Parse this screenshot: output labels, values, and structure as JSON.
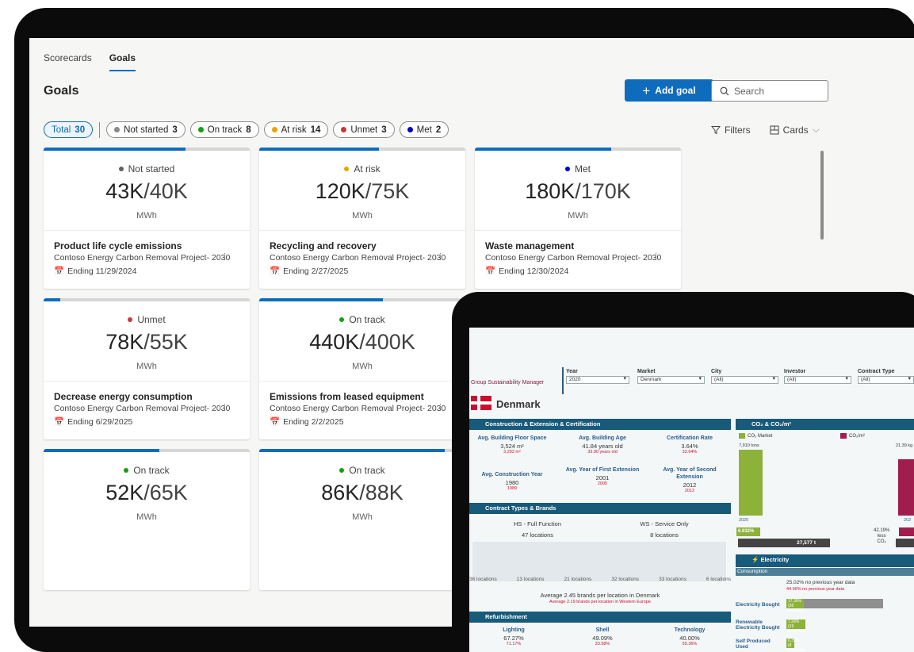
{
  "goals_app": {
    "tabs": [
      {
        "label": "Scorecards"
      },
      {
        "label": "Goals"
      }
    ],
    "page_title": "Goals",
    "add_goal_label": "Add goal",
    "search_placeholder": "Search",
    "chips": {
      "total": {
        "label": "Total",
        "count": "30"
      },
      "not_started": {
        "label": "Not started",
        "count": "3",
        "color": "#8a8a8a"
      },
      "on_track": {
        "label": "On track",
        "count": "8",
        "color": "#13a10e"
      },
      "at_risk": {
        "label": "At risk",
        "count": "14",
        "color": "#eaa300"
      },
      "unmet": {
        "label": "Unmet",
        "count": "3",
        "color": "#d13438"
      },
      "met": {
        "label": "Met",
        "count": "2",
        "color": "#0000c8"
      }
    },
    "filters_label": "Filters",
    "view_label": "Cards",
    "cards": [
      {
        "status": "Not started",
        "status_color": "#616161",
        "value": "43K",
        "target": "/40K",
        "unit": "MWh",
        "progress": 0.69,
        "name": "Product life cycle emissions",
        "project": "Contoso Energy Carbon Removal Project- 2030",
        "ending": "Ending 11/29/2024"
      },
      {
        "status": "At risk",
        "status_color": "#eaa300",
        "value": "120K",
        "target": "/75K",
        "unit": "MWh",
        "progress": 0.58,
        "name": "Recycling and recovery",
        "project": "Contoso Energy Carbon Removal Project- 2030",
        "ending": "Ending 2/27/2025"
      },
      {
        "status": "Met",
        "status_color": "#0000c8",
        "value": "180K",
        "target": "/170K",
        "unit": "MWh",
        "progress": 0.66,
        "name": "Waste management",
        "project": "Contoso Energy Carbon Removal Project- 2030",
        "ending": "Ending 12/30/2024"
      },
      {
        "status": "Unmet",
        "status_color": "#d13438",
        "value": "78K",
        "target": "/55K",
        "unit": "MWh",
        "progress": 0.08,
        "name": "Decrease energy consumption",
        "project": "Contoso Energy Carbon Removal Project- 2030",
        "ending": "Ending 6/29/2025"
      },
      {
        "status": "On track",
        "status_color": "#13a10e",
        "value": "440K",
        "target": "/400K",
        "unit": "MWh",
        "progress": 0.6,
        "name": "Emissions from leased equipment",
        "project": "Contoso Energy Carbon Removal Project- 2030",
        "ending": "Ending 2/2/2025"
      },
      {
        "status": "On track",
        "status_color": "#13a10e",
        "value": "52K",
        "target": "/65K",
        "unit": "MWh",
        "progress": 0.56
      },
      {
        "status": "On track",
        "status_color": "#13a10e",
        "value": "86K",
        "target": "/88K",
        "unit": "MWh",
        "progress": 0.9
      }
    ]
  },
  "dashboard": {
    "role": "Group Sustainability Manager",
    "filters": [
      {
        "label": "Year",
        "value": "2020"
      },
      {
        "label": "Market",
        "value": "Denmark"
      },
      {
        "label": "City",
        "value": "(All)"
      },
      {
        "label": "Investor",
        "value": "(All)"
      },
      {
        "label": "Contract Type",
        "value": "(All)"
      }
    ],
    "country": "Denmark",
    "construction_title": "Construction & Extension & Certification",
    "stats": [
      {
        "label": "Avg. Building Floor Space",
        "value": "3,524 m²",
        "sub": "3,292 m²"
      },
      {
        "label": "Avg. Building Age",
        "value": "41.84 years old",
        "sub": "33.90 years old"
      },
      {
        "label": "Certification Rate",
        "value": "3.64%",
        "sub": "32.64%"
      },
      {
        "label": "Avg. Construction Year",
        "value": "1980",
        "sub": "1989"
      },
      {
        "label": "Avg. Year of First Extension",
        "value": "2001",
        "sub": "2005"
      },
      {
        "label": "Avg. Year of Second Extension",
        "value": "2012",
        "sub": "2012"
      }
    ],
    "contract_title": "Contract Types & Brands",
    "contract_types": [
      {
        "label": "HS - Full Function",
        "locations": "47 locations"
      },
      {
        "label": "WS - Service Only",
        "locations": "8 locations"
      }
    ],
    "location_counts": [
      "36 locations",
      "13 locations",
      "21 locations",
      "32 locations",
      "33 locations",
      "6 locations"
    ],
    "avg_brands": "Average 2.45 brands per location in Denmark",
    "avg_brands_sub": "Average 2.19 brands per location in Western Europe",
    "refurb_title": "Refurbishment",
    "refurb": [
      {
        "label": "Lighting",
        "value": "67.27%",
        "sub": "71.17%"
      },
      {
        "label": "Shell",
        "value": "49.09%",
        "sub": "33.58%"
      },
      {
        "label": "Technology",
        "value": "40.00%",
        "sub": "55.36%"
      }
    ],
    "co2_title": "CO₂ & CO₂/m²",
    "co2_legend": [
      "CO₂ Market",
      "CO₂/m²"
    ],
    "co2_value_top": "7,910 tons",
    "co2_value_right": "21.39 kg",
    "co2_year": "2020",
    "co2_year_right": "202",
    "co2_pct_left": "6.932%",
    "co2_pct_right": "42.19%",
    "co2_less": "less",
    "co2_unit": "CO₂",
    "co2_bottom": "27,577 t",
    "elec_title": "Electricity",
    "consumption_label": "Consumption",
    "consumption_pct": "25.02% no previous year data",
    "consumption_pct_sub": "44.96% no previous year data",
    "elec_rows": [
      {
        "label": "Electricity Bought",
        "pct": "17.36%",
        "sub": "(36 locations)"
      },
      {
        "label": "Renewable Electricity Bought",
        "pct": "7.28%",
        "sub": "(19 locations)"
      },
      {
        "label": "Self Produced Used",
        "pct": "0.39%",
        "sub": "(8 locations)"
      }
    ],
    "colors": {
      "header_bar": "#175a7a",
      "accent_red": "#c8102e",
      "green": "#8db23a",
      "maroon": "#a01d4e"
    }
  }
}
